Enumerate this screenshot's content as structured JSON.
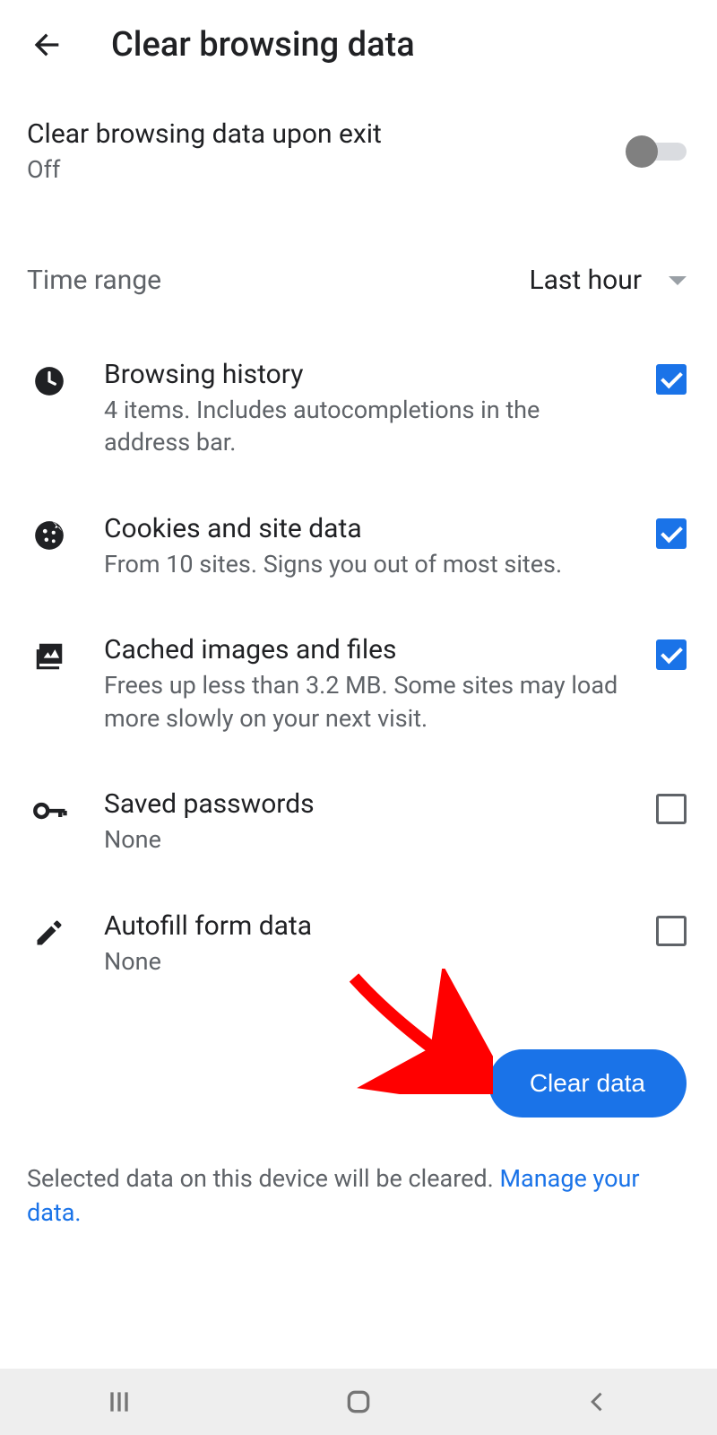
{
  "header": {
    "title": "Clear browsing data"
  },
  "exitSetting": {
    "label": "Clear browsing data upon exit",
    "status": "Off"
  },
  "timeRange": {
    "label": "Time range",
    "value": "Last hour"
  },
  "items": [
    {
      "title": "Browsing history",
      "desc": "4 items. Includes autocompletions in the address bar.",
      "checked": true
    },
    {
      "title": "Cookies and site data",
      "desc": "From 10 sites. Signs you out of most sites.",
      "checked": true
    },
    {
      "title": "Cached images and files",
      "desc": "Frees up less than 3.2 MB. Some sites may load more slowly on your next visit.",
      "checked": true
    },
    {
      "title": "Saved passwords",
      "desc": "None",
      "checked": false
    },
    {
      "title": "Autofill form data",
      "desc": "None",
      "checked": false
    }
  ],
  "clearButton": "Clear data",
  "footer": {
    "textA": "Selected data on this device will be cleared. ",
    "link": "Manage your data."
  }
}
